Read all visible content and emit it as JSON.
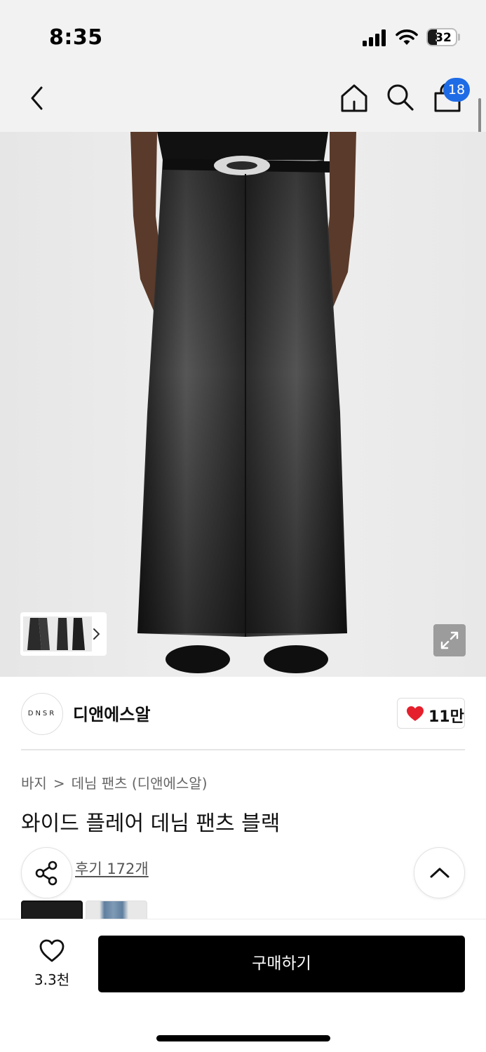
{
  "status_bar": {
    "time": "8:35",
    "battery_level": "32",
    "icons": [
      "signal-icon",
      "wifi-icon",
      "battery-icon"
    ]
  },
  "nav": {
    "icons": [
      "back-arrow-icon",
      "home-icon",
      "search-icon",
      "shopping-bag-icon"
    ],
    "cart_badge": "18"
  },
  "hero": {
    "icons": [
      "chevron-right-icon",
      "expand-icon"
    ]
  },
  "brand": {
    "logo_text": "DNSR",
    "name": "디앤에스알",
    "like_count": "11만",
    "like_icon": "heart-filled-icon",
    "like_color": "#e5202c"
  },
  "product": {
    "breadcrumb": [
      "바지",
      "데님 팬츠 (디앤에스알)"
    ],
    "title": "와이드 플레어 데님 팬츠 블랙",
    "review_link": "후기 172개",
    "icons": [
      "share-icon",
      "chevron-up-icon"
    ]
  },
  "bottom_bar": {
    "wishlist_count": "3.3천",
    "wishlist_icon": "heart-outline-icon",
    "buy_label": "구매하기"
  },
  "colors": {
    "accent": "#1e6be6",
    "button": "#000000",
    "heart": "#e5202c"
  }
}
